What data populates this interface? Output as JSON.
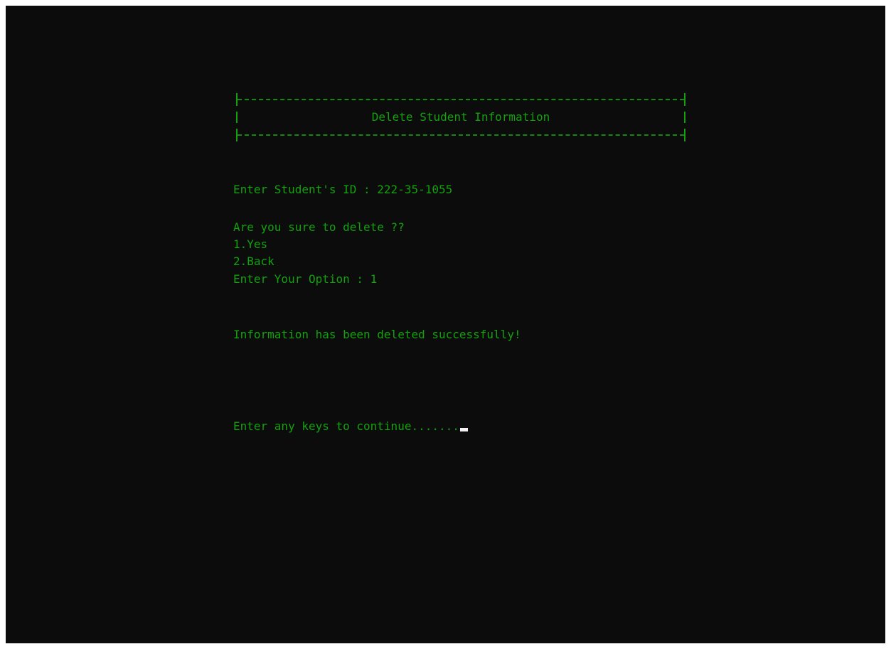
{
  "banner": {
    "title": "Delete Student Information"
  },
  "prompts": {
    "student_id": "Enter Student's ID : 222-35-1055",
    "confirm": "Are you sure to delete ??",
    "option_yes": "1.Yes",
    "option_back": "2.Back",
    "option_entry": "Enter Your Option : 1",
    "result": "Information has been deleted successfully!",
    "continue": "Enter any keys to continue......."
  },
  "colors": {
    "background": "#0c0c0c",
    "text": "#13a10e",
    "cursor": "#f2f2f2"
  }
}
